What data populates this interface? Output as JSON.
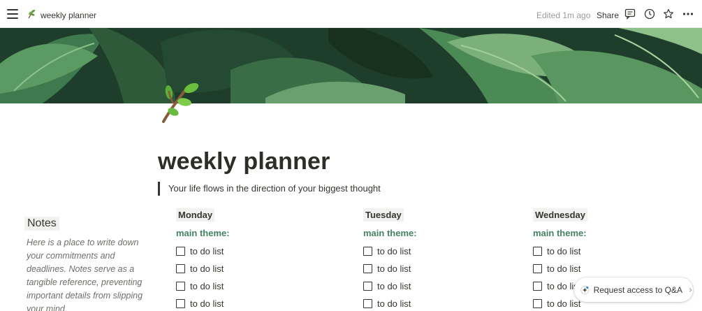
{
  "topbar": {
    "title": "weekly planner",
    "edited": "Edited 1m ago",
    "share_label": "Share"
  },
  "page": {
    "title": "weekly planner",
    "quote": "Your life flows in the direction of your biggest thought",
    "icon": "seedling-branch-icon"
  },
  "notes": {
    "heading": "Notes",
    "body": "Here is a place to write down your commitments and deadlines. Notes serve as a tangible reference, preventing important details from slipping your mind."
  },
  "days": [
    {
      "name": "Monday",
      "theme": "main theme:",
      "todos": [
        "to do list",
        "to do list",
        "to do list",
        "to do list"
      ]
    },
    {
      "name": "Tuesday",
      "theme": "main theme:",
      "todos": [
        "to do list",
        "to do list",
        "to do list",
        "to do list"
      ]
    },
    {
      "name": "Wednesday",
      "theme": "main theme:",
      "todos": [
        "to do list",
        "to do list",
        "to do list",
        "to do list"
      ]
    }
  ],
  "qa_button": {
    "label": "Request access to Q&A"
  },
  "colors": {
    "accent_green": "#448361",
    "text": "#37352f",
    "muted": "#9b9a97"
  }
}
